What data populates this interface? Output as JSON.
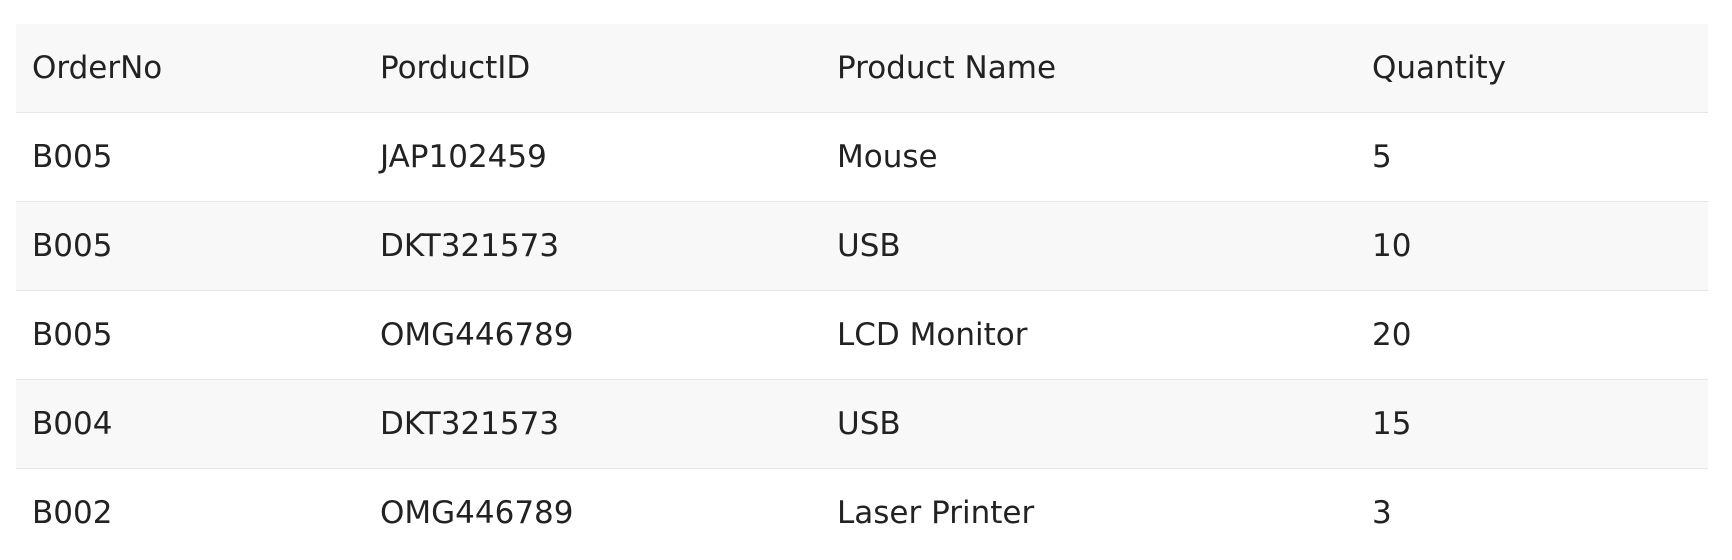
{
  "table": {
    "headers": [
      "OrderNo",
      "PorductID",
      "Product Name",
      "Quantity"
    ],
    "rows": [
      [
        "B005",
        "JAP102459",
        "Mouse",
        "5"
      ],
      [
        "B005",
        "DKT321573",
        "USB",
        "10"
      ],
      [
        "B005",
        "OMG446789",
        "LCD Monitor",
        "20"
      ],
      [
        "B004",
        "DKT321573",
        "USB",
        "15"
      ],
      [
        "B002",
        "OMG446789",
        "Laser Printer",
        "3"
      ]
    ]
  }
}
